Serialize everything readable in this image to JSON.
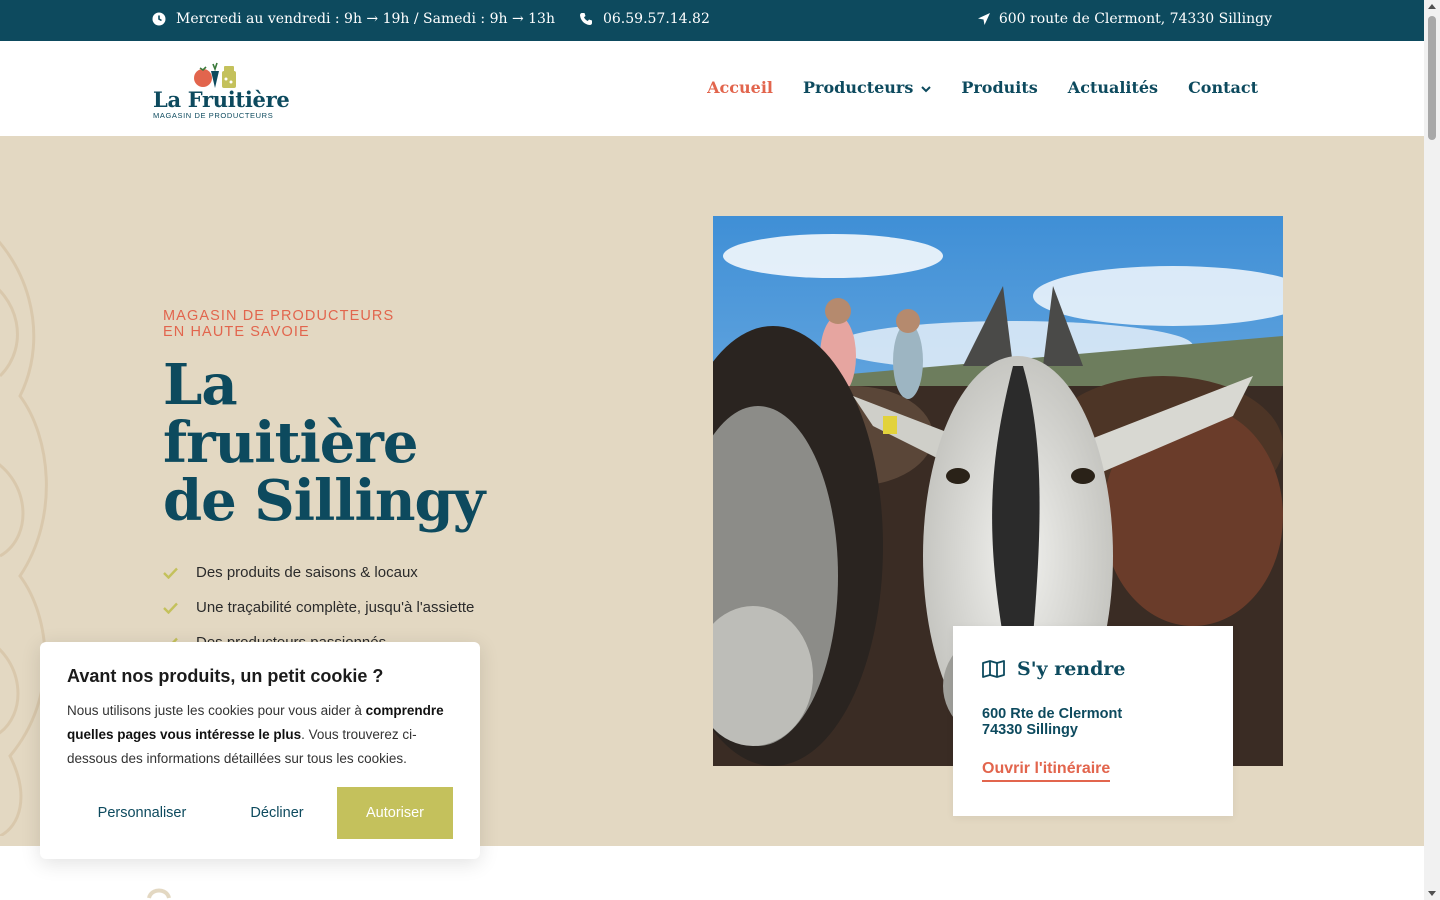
{
  "topbar": {
    "hours": "Mercredi au vendredi : 9h → 19h / Samedi : 9h → 13h",
    "phone": "06.59.57.14.82",
    "address": "600 route de Clermont, 74330 Sillingy",
    "background": "#0d4a5e"
  },
  "logo": {
    "title": "La Fruitière",
    "subtitle": "MAGASIN DE PRODUCTEURS"
  },
  "nav": {
    "items": [
      {
        "label": "Accueil",
        "active": true
      },
      {
        "label": "Producteurs",
        "has_dropdown": true
      },
      {
        "label": "Produits"
      },
      {
        "label": "Actualités"
      },
      {
        "label": "Contact"
      }
    ]
  },
  "hero": {
    "kicker_line1": "MAGASIN DE PRODUCTEURS",
    "kicker_line2": "EN HAUTE SAVOIE",
    "title_line1": "La",
    "title_line2": "fruitière",
    "title_line3": "de Sillingy",
    "checks": [
      "Des produits de saisons & locaux",
      "Une traçabilité complète, jusqu'à l'assiette",
      "Des producteurs passionnés"
    ]
  },
  "route_card": {
    "title": "S'y rendre",
    "address_line1": "600 Rte de Clermont",
    "address_line2": "74330 Sillingy",
    "link": "Ouvrir l'itinéraire"
  },
  "cookie": {
    "title": "Avant nos produits, un petit cookie ?",
    "text_before": "Nous utilisons juste les cookies pour vous aider à ",
    "text_bold": "comprendre quelles pages vous intéresse le plus",
    "text_after": ". Vous trouverez ci-dessous des informations détaillées sur tous les cookies.",
    "customize": "Personnaliser",
    "decline": "Décliner",
    "accept": "Autoriser"
  },
  "colors": {
    "primary": "#0d4a5e",
    "accent": "#e2654d",
    "olive": "#c4c15c",
    "beige": "#e3d8c2"
  }
}
